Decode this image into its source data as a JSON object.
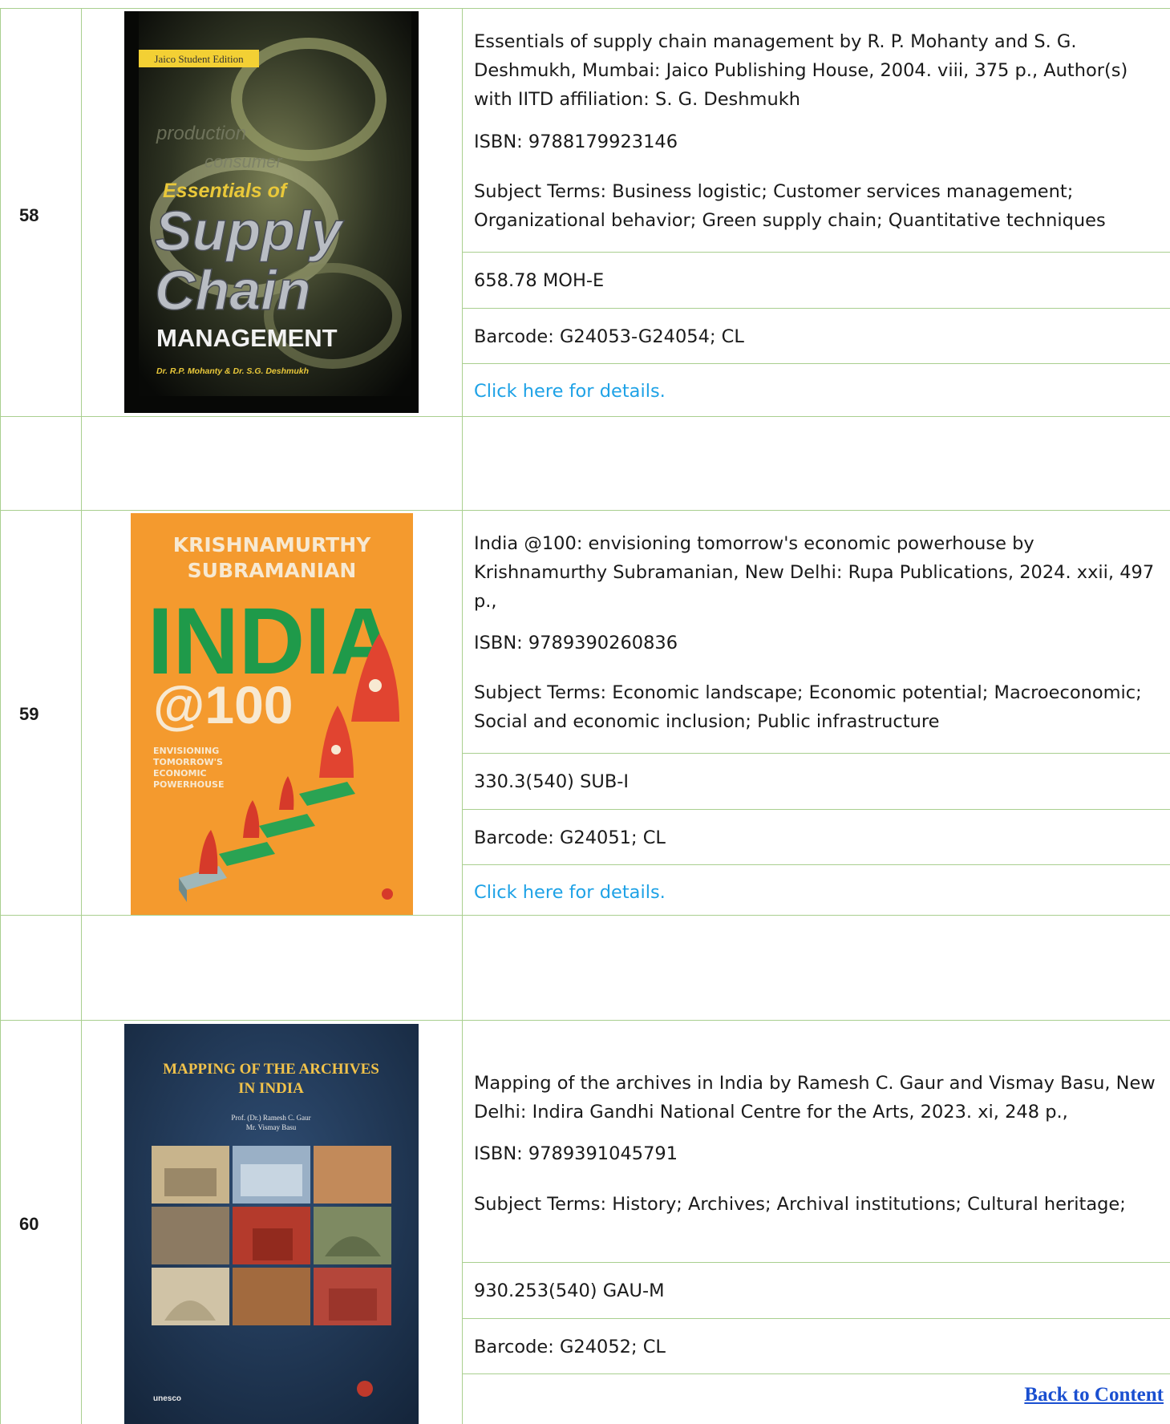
{
  "rows": [
    {
      "number": "58",
      "cover": {
        "edition_badge": "Jaico Student Edition",
        "faded_words": [
          "production",
          "consumer"
        ],
        "title_top": "Essentials of",
        "title_line1": "Supply",
        "title_line2": "Chain",
        "title_line3": "MANAGEMENT",
        "authors": "Dr. R.P. Mohanty & Dr. S.G. Deshmukh"
      },
      "description": "Essentials of supply chain management by R. P. Mohanty and S. G. Deshmukh, Mumbai: Jaico Publishing House, 2004. viii, 375 p., Author(s) with IITD affiliation: S. G. Deshmukh",
      "isbn": "ISBN: 9788179923146",
      "subjects": "Subject Terms: Business logistic; Customer services management; Organizational behavior; Green supply chain; Quantitative techniques",
      "call_number": "658.78 MOH-E",
      "barcode": "Barcode: G24053-G24054; CL",
      "details_link": "Click here for details."
    },
    {
      "number": "59",
      "cover": {
        "author_line1": "KRISHNAMURTHY",
        "author_line2": "SUBRAMANIAN",
        "title_line1": "INDIA",
        "title_line2": "@100",
        "subtitle_lines": [
          "ENVISIONING",
          "TOMORROW'S",
          "ECONOMIC",
          "POWERHOUSE"
        ]
      },
      "description": "India @100: envisioning tomorrow's economic powerhouse by Krishnamurthy Subramanian, New Delhi: Rupa Publications, 2024. xxii, 497 p.,",
      "isbn": "ISBN: 9789390260836",
      "subjects": "Subject Terms: Economic landscape; Economic potential; Macroeconomic; Social and economic inclusion; Public infrastructure",
      "call_number": "330.3(540) SUB-I",
      "barcode": "Barcode: G24051; CL",
      "details_link": "Click here for details."
    },
    {
      "number": "60",
      "cover": {
        "title_line1": "MAPPING OF THE ARCHIVES",
        "title_line2": "IN INDIA",
        "author_line1": "Prof. (Dr.) Ramesh C. Gaur",
        "author_line2": "Mr. Vismay Basu",
        "publisher_logo": "unesco"
      },
      "description": "Mapping of the archives in India by Ramesh C. Gaur and Vismay Basu, New Delhi: Indira Gandhi National Centre for the Arts, 2023. xi, 248 p.,",
      "isbn": "ISBN: 9789391045791",
      "subjects": "Subject Terms: History; Archives; Archival institutions; Cultural heritage;",
      "call_number": "930.253(540) GAU-M",
      "barcode": "Barcode: G24052; CL",
      "back_link": "Back to Content"
    }
  ],
  "colors": {
    "grid": "#a9cf8f",
    "link": "#1ea2e6",
    "back_link": "#1a4fd0"
  }
}
